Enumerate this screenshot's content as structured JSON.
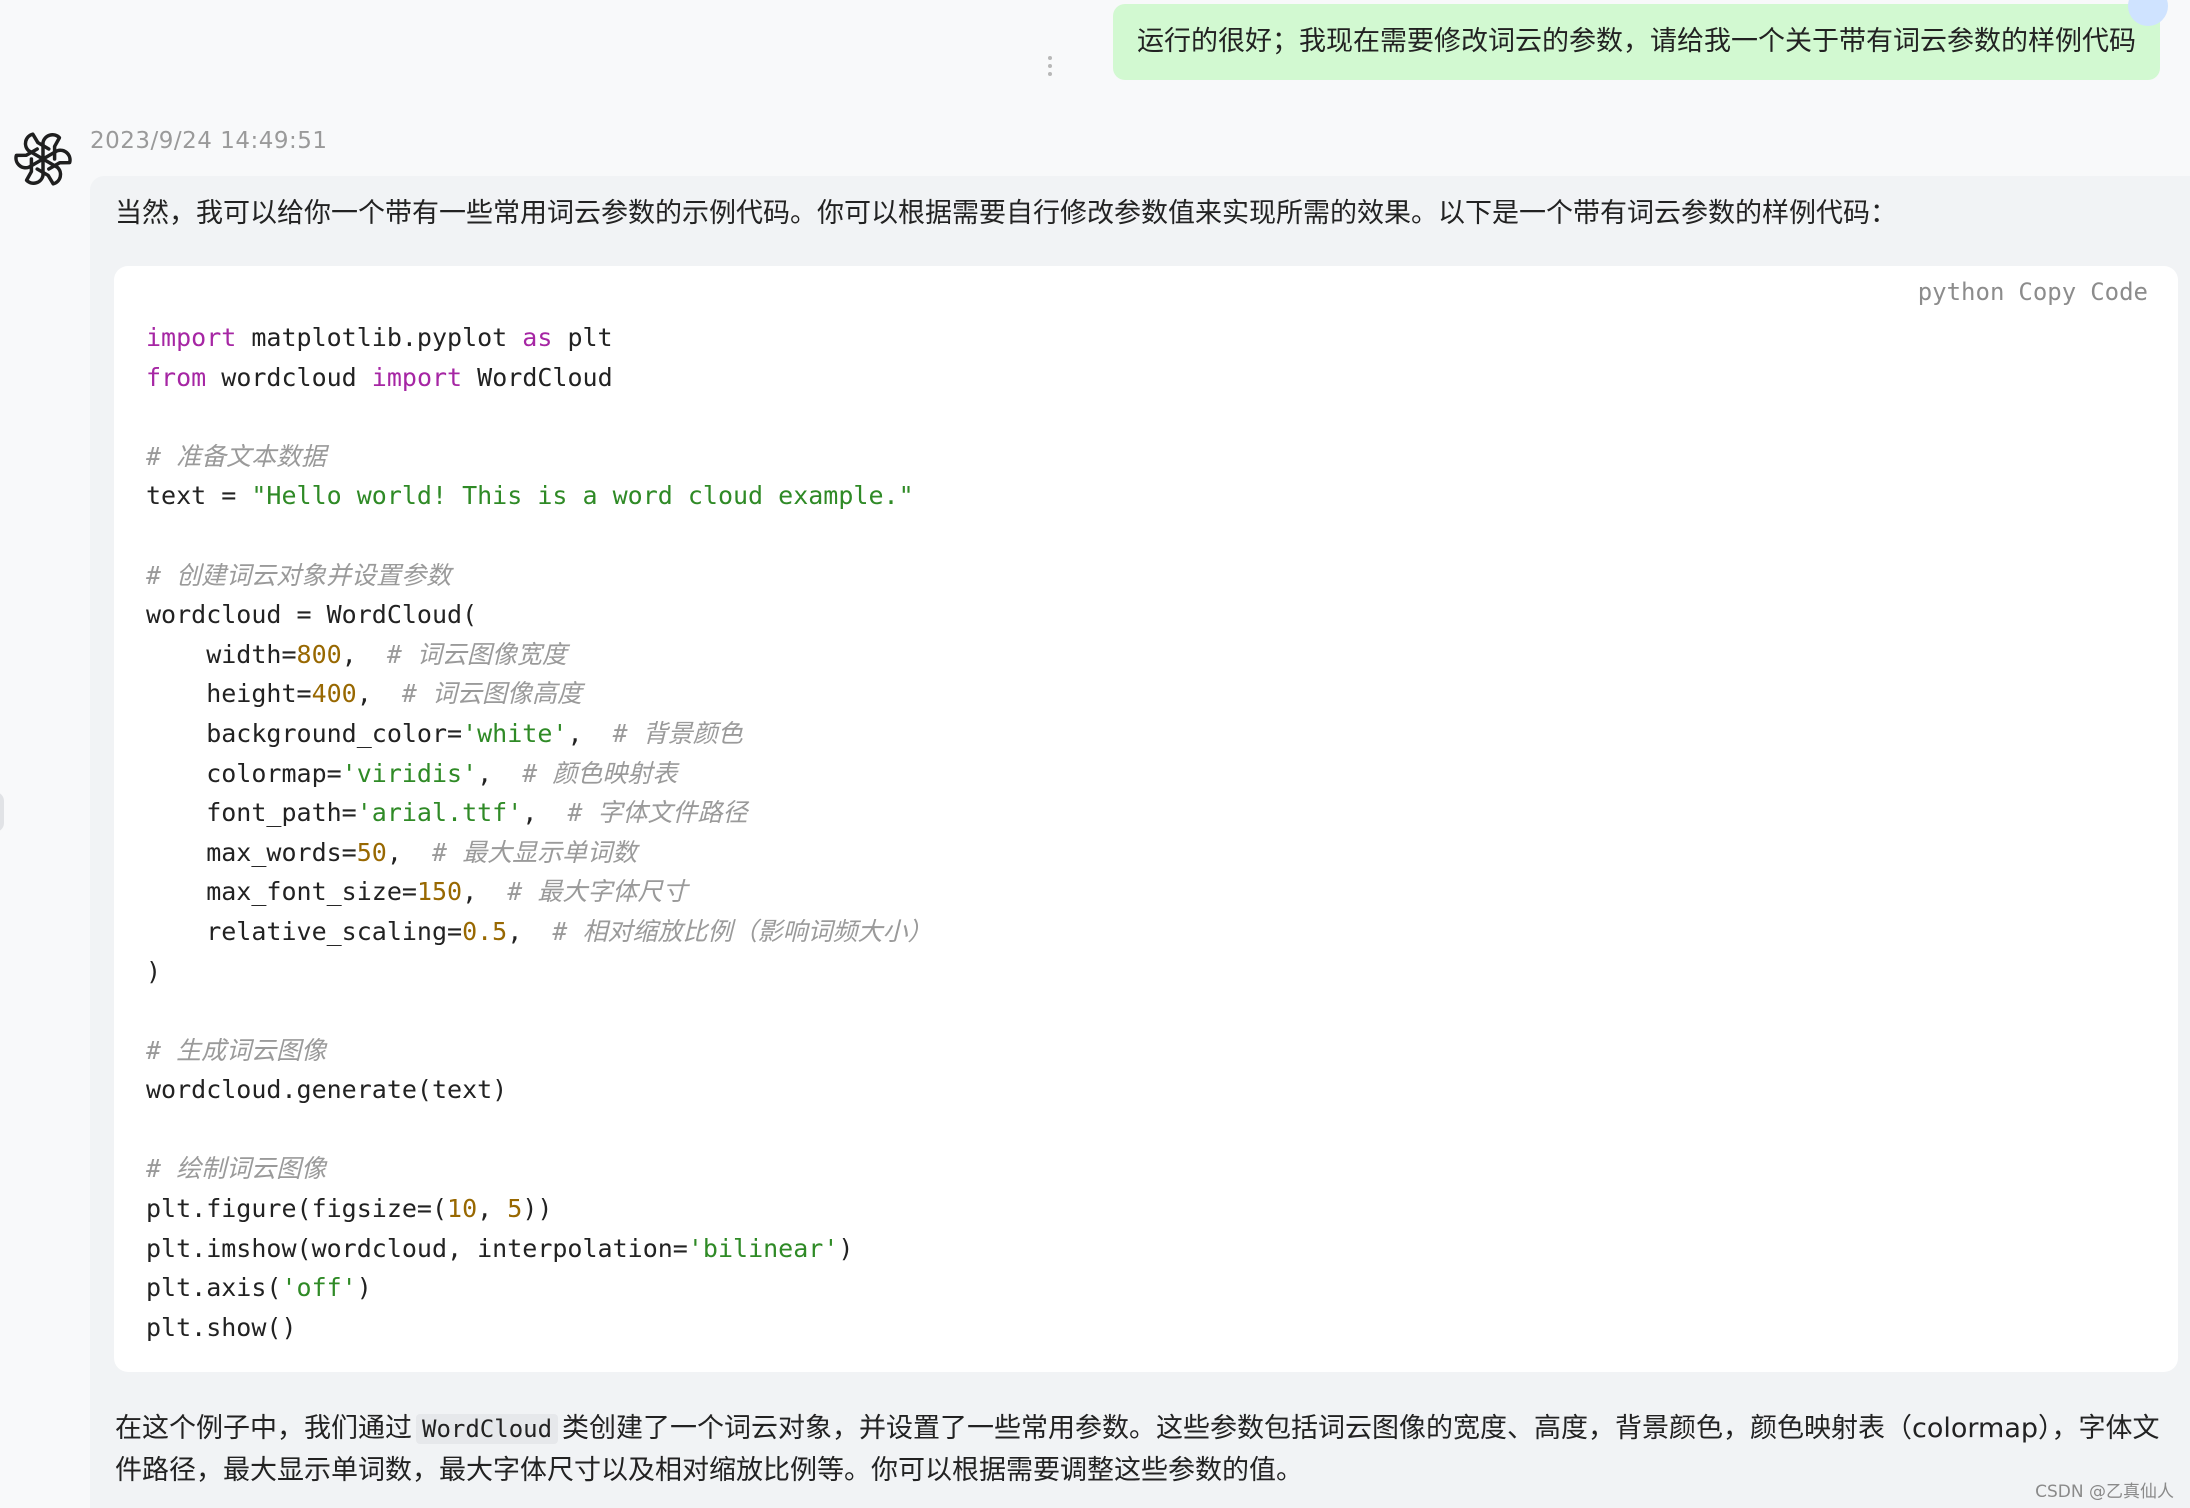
{
  "user_message": {
    "text": "运行的很好；我现在需要修改词云的参数，请给我一个关于带有词云参数的样例代码"
  },
  "assistant_message": {
    "timestamp": "2023/9/24 14:49:51",
    "intro": "当然，我可以给你一个带有一些常用词云参数的示例代码。你可以根据需要自行修改参数值来实现所需的效果。以下是一个带有词云参数的样例代码：",
    "code_toolbar": {
      "language": "python",
      "copy_label": "Copy",
      "code_label": "Code"
    },
    "code_lines": [
      [
        [
          "kw",
          "import"
        ],
        [
          "plain",
          " matplotlib.pyplot "
        ],
        [
          "kw",
          "as"
        ],
        [
          "plain",
          " plt"
        ]
      ],
      [
        [
          "kw",
          "from"
        ],
        [
          "plain",
          " wordcloud "
        ],
        [
          "kw",
          "import"
        ],
        [
          "plain",
          " WordCloud"
        ]
      ],
      [],
      [
        [
          "cm",
          "# 准备文本数据"
        ]
      ],
      [
        [
          "plain",
          "text = "
        ],
        [
          "str",
          "\"Hello world! This is a word cloud example.\""
        ]
      ],
      [],
      [
        [
          "cm",
          "# 创建词云对象并设置参数"
        ]
      ],
      [
        [
          "plain",
          "wordcloud = WordCloud("
        ]
      ],
      [
        [
          "plain",
          "    width="
        ],
        [
          "num",
          "800"
        ],
        [
          "plain",
          ",  "
        ],
        [
          "cm",
          "# 词云图像宽度"
        ]
      ],
      [
        [
          "plain",
          "    height="
        ],
        [
          "num",
          "400"
        ],
        [
          "plain",
          ",  "
        ],
        [
          "cm",
          "# 词云图像高度"
        ]
      ],
      [
        [
          "plain",
          "    background_color="
        ],
        [
          "str",
          "'white'"
        ],
        [
          "plain",
          ",  "
        ],
        [
          "cm",
          "# 背景颜色"
        ]
      ],
      [
        [
          "plain",
          "    colormap="
        ],
        [
          "str",
          "'viridis'"
        ],
        [
          "plain",
          ",  "
        ],
        [
          "cm",
          "# 颜色映射表"
        ]
      ],
      [
        [
          "plain",
          "    font_path="
        ],
        [
          "str",
          "'arial.ttf'"
        ],
        [
          "plain",
          ",  "
        ],
        [
          "cm",
          "# 字体文件路径"
        ]
      ],
      [
        [
          "plain",
          "    max_words="
        ],
        [
          "num",
          "50"
        ],
        [
          "plain",
          ",  "
        ],
        [
          "cm",
          "# 最大显示单词数"
        ]
      ],
      [
        [
          "plain",
          "    max_font_size="
        ],
        [
          "num",
          "150"
        ],
        [
          "plain",
          ",  "
        ],
        [
          "cm",
          "# 最大字体尺寸"
        ]
      ],
      [
        [
          "plain",
          "    relative_scaling="
        ],
        [
          "num",
          "0.5"
        ],
        [
          "plain",
          ",  "
        ],
        [
          "cm",
          "# 相对缩放比例（影响词频大小）"
        ]
      ],
      [
        [
          "plain",
          ")"
        ]
      ],
      [],
      [
        [
          "cm",
          "# 生成词云图像"
        ]
      ],
      [
        [
          "plain",
          "wordcloud.generate(text)"
        ]
      ],
      [],
      [
        [
          "cm",
          "# 绘制词云图像"
        ]
      ],
      [
        [
          "plain",
          "plt.figure(figsize=("
        ],
        [
          "num",
          "10"
        ],
        [
          "plain",
          ", "
        ],
        [
          "num",
          "5"
        ],
        [
          "plain",
          "))"
        ]
      ],
      [
        [
          "plain",
          "plt.imshow(wordcloud, interpolation="
        ],
        [
          "str",
          "'bilinear'"
        ],
        [
          "plain",
          ")"
        ]
      ],
      [
        [
          "plain",
          "plt.axis("
        ],
        [
          "str",
          "'off'"
        ],
        [
          "plain",
          ")"
        ]
      ],
      [
        [
          "plain",
          "plt.show()"
        ]
      ]
    ],
    "outro_before": "在这个例子中，我们通过",
    "outro_code": "WordCloud",
    "outro_after": "类创建了一个词云对象，并设置了一些常用参数。这些参数包括词云图像的宽度、高度，背景颜色，颜色映射表（colormap），字体文件路径，最大显示单词数，最大字体尺寸以及相对缩放比例等。你可以根据需要调整这些参数的值。"
  },
  "watermark": "CSDN @乙真仙人",
  "colors": {
    "user_bubble": "#d2f9d1",
    "card_bg": "#f1f3f5",
    "keyword": "#a626a4",
    "string": "#2f8a26",
    "number": "#986801",
    "comment": "#9a9a9a"
  },
  "icons": {
    "assistant_avatar": "openai-logo-icon",
    "message_menu": "more-vertical-icon"
  }
}
